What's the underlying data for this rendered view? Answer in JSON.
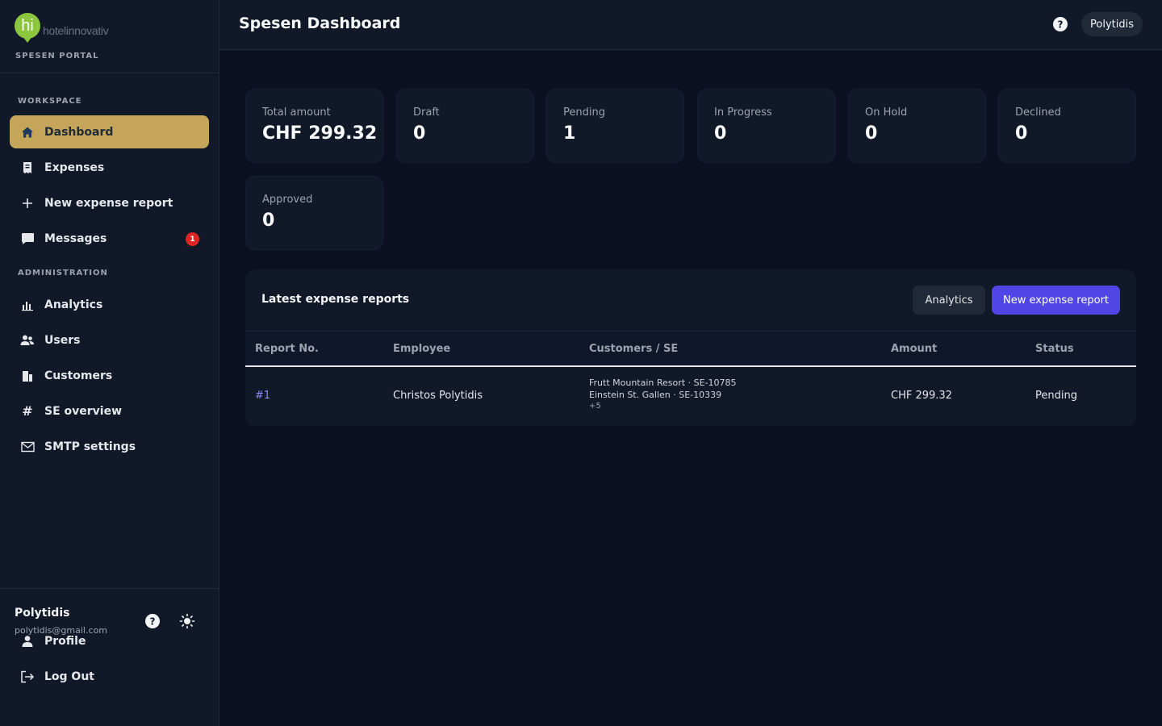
{
  "brand": {
    "logo_mark": "hi",
    "logo_text": "hotelinnovativ",
    "portal_label": "SPESEN PORTAL"
  },
  "sidebar": {
    "workspace_label": "WORKSPACE",
    "workspace_items": [
      {
        "label": "Dashboard",
        "icon": "home-icon",
        "active": true
      },
      {
        "label": "Expenses",
        "icon": "receipt-icon"
      },
      {
        "label": "New expense report",
        "icon": "plus-icon"
      },
      {
        "label": "Messages",
        "icon": "chat-icon",
        "badge": "1"
      }
    ],
    "admin_label": "ADMINISTRATION",
    "admin_items": [
      {
        "label": "Analytics",
        "icon": "bar-chart-icon"
      },
      {
        "label": "Users",
        "icon": "users-icon"
      },
      {
        "label": "Customers",
        "icon": "building-icon"
      },
      {
        "label": "SE overview",
        "icon": "hash-icon"
      },
      {
        "label": "SMTP settings",
        "icon": "mail-icon"
      }
    ],
    "footer": {
      "user_name": "Polytidis",
      "user_email": "polytidis@gmail.com",
      "items": [
        {
          "label": "Profile",
          "icon": "user-icon"
        },
        {
          "label": "Log Out",
          "icon": "logout-icon"
        }
      ]
    }
  },
  "header": {
    "title": "Spesen Dashboard",
    "user_chip": "Polytidis"
  },
  "stats": [
    {
      "label": "Total amount",
      "value": "CHF 299.32"
    },
    {
      "label": "Draft",
      "value": "0"
    },
    {
      "label": "Pending",
      "value": "1"
    },
    {
      "label": "In Progress",
      "value": "0"
    },
    {
      "label": "On Hold",
      "value": "0"
    },
    {
      "label": "Declined",
      "value": "0"
    },
    {
      "label": "Approved",
      "value": "0"
    }
  ],
  "latest": {
    "title": "Latest expense reports",
    "analytics_button": "Analytics",
    "new_report_button": "New expense report",
    "columns": [
      "Report No.",
      "Employee",
      "Customers / SE",
      "Amount",
      "Status"
    ],
    "rows": [
      {
        "report_no": "#1",
        "employee": "Christos Polytidis",
        "customers": [
          "Frutt Mountain Resort · SE-10785",
          "Einstein St. Gallen · SE-10339"
        ],
        "customers_more": "+5",
        "amount": "CHF 299.32",
        "status": "Pending"
      }
    ]
  },
  "colors": {
    "background": "#0b1120",
    "panel": "#111827",
    "active_nav": "#c5a55a",
    "primary_button": "#5046e5",
    "logo_green": "#8cc63f",
    "badge_red": "#dc2626"
  }
}
